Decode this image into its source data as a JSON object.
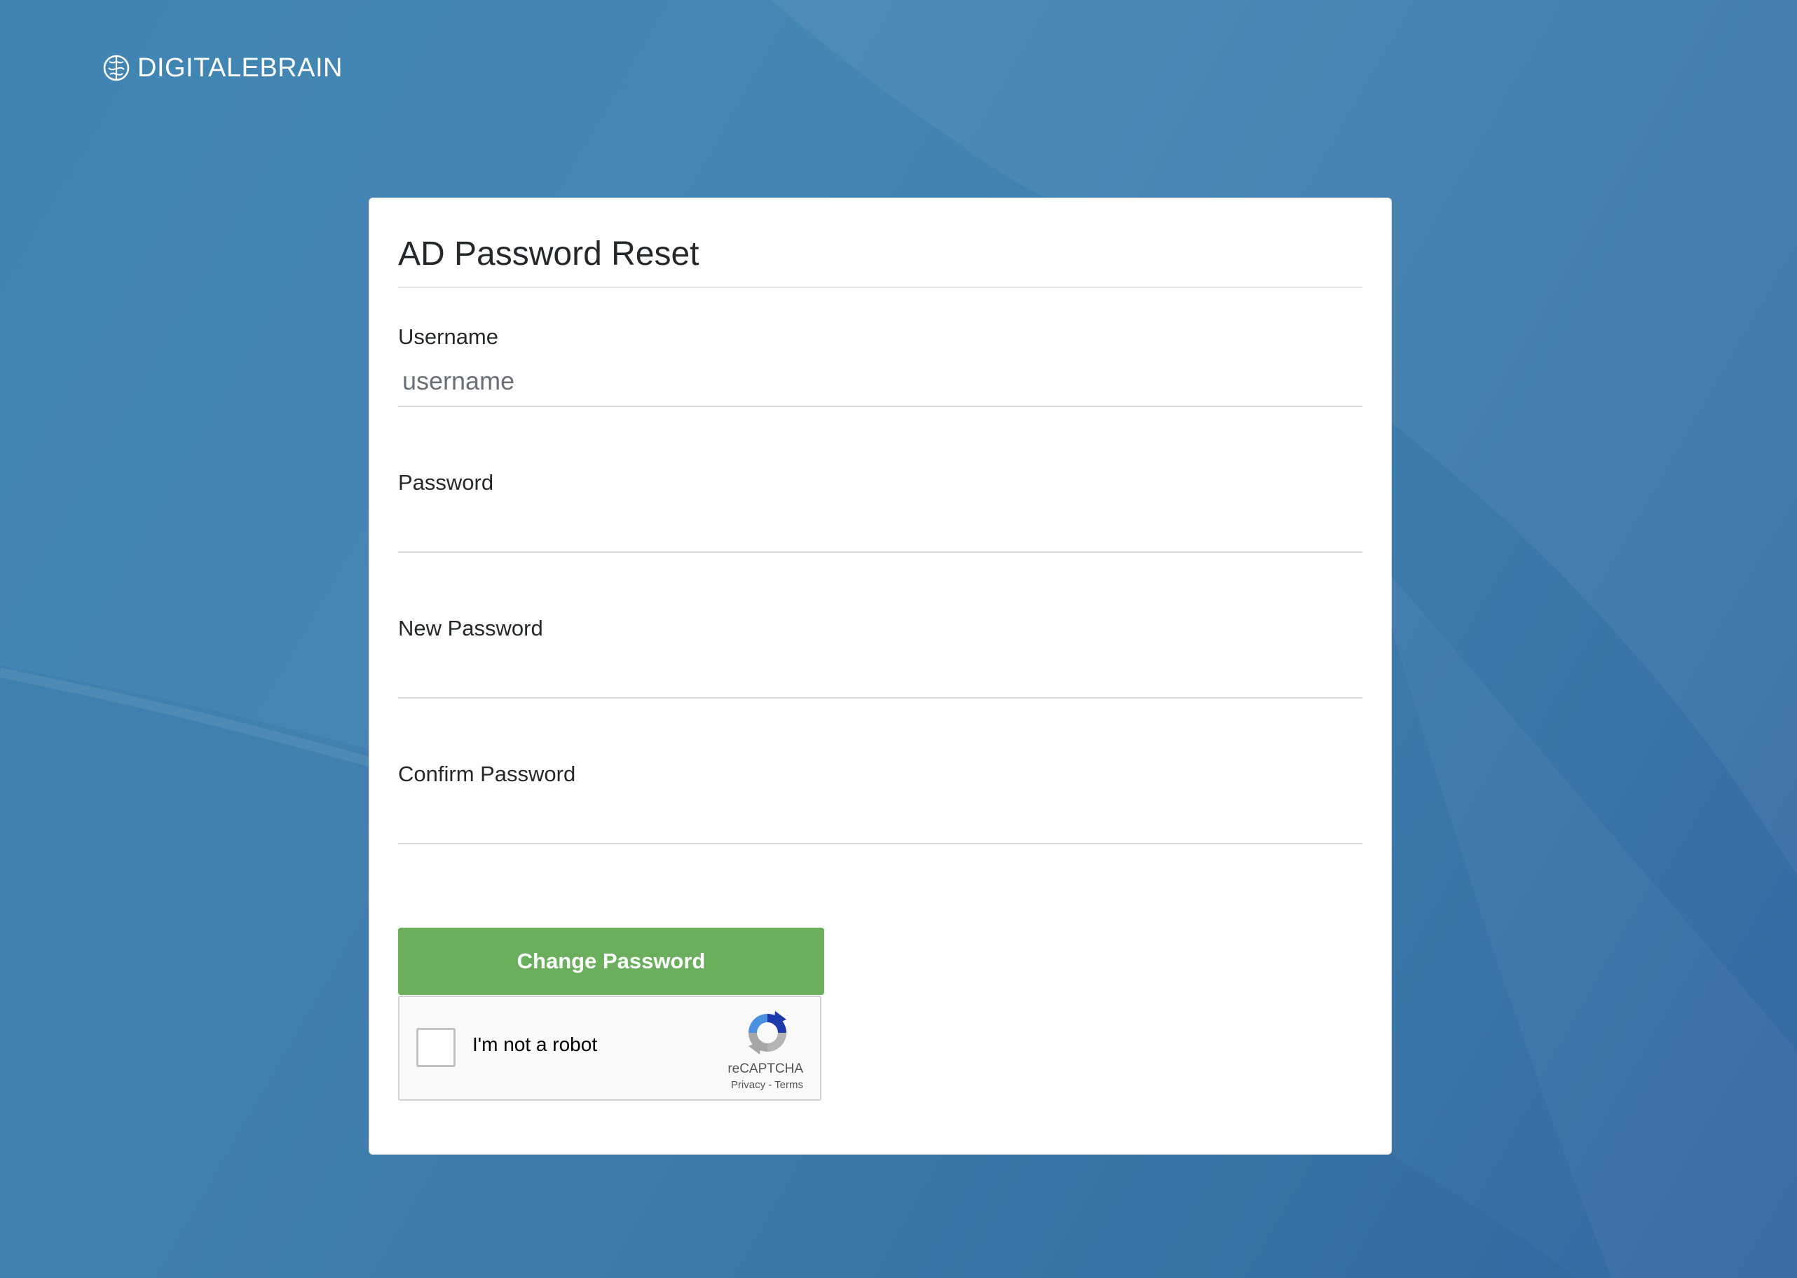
{
  "brand": {
    "name": "DIGITALEBRAIN",
    "icon": "brain-icon"
  },
  "form": {
    "title": "AD Password Reset",
    "fields": [
      {
        "label": "Username",
        "placeholder": "username",
        "type": "text",
        "value": ""
      },
      {
        "label": "Password",
        "placeholder": "",
        "type": "password",
        "value": ""
      },
      {
        "label": "New Password",
        "placeholder": "",
        "type": "password",
        "value": ""
      },
      {
        "label": "Confirm Password",
        "placeholder": "",
        "type": "password",
        "value": ""
      }
    ],
    "submit_label": "Change Password"
  },
  "recaptcha": {
    "label": "I'm not a robot",
    "checked": false,
    "brand": "reCAPTCHA",
    "privacy": "Privacy",
    "separator": " - ",
    "terms": "Terms",
    "icon": "recaptcha-logo-icon"
  },
  "colors": {
    "background": "#3f84b3",
    "card": "#ffffff",
    "button": "#6aae5e",
    "button_text": "#ffffff"
  }
}
